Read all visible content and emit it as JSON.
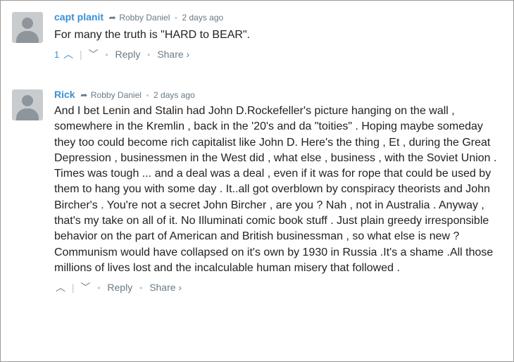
{
  "comments": [
    {
      "author": "capt planit",
      "reply_to": "Robby Daniel",
      "time": "2 days ago",
      "message": "For many the truth is \"HARD to BEAR\".",
      "votes": "1",
      "reply_label": "Reply",
      "share_label": "Share ›"
    },
    {
      "author": "Rick",
      "reply_to": "Robby Daniel",
      "time": "2 days ago",
      "message": "And I bet Lenin and Stalin had John D.Rockefeller's picture hanging on the wall , somewhere in the Kremlin , back in the '20's and da \"toities\" . Hoping maybe someday they too could become rich capitalist like John D. Here's the thing , Et , during the Great Depression , businessmen in the West did , what else , business , with the Soviet Union . Times was tough ... and a deal was a deal , even if it was for rope that could be used by them to hang you with some day . It..all got overblown by conspiracy theorists and John Bircher's . You're not a secret John Bircher , are you ? Nah , not in Australia . Anyway , that's my take on all of it. No Illuminati comic book stuff . Just plain greedy irresponsible behavior on the part of American and British businessman , so what else is new ? Communism would have collapsed on it's own by 1930 in Russia .It's a shame .All those millions of lives lost and the incalculable human misery that followed .",
      "reply_label": "Reply",
      "share_label": "Share ›"
    }
  ],
  "icons": {
    "avatar": "default-user-avatar",
    "reply_arrow": "reply-arrow-icon",
    "upvote": "chevron-up-icon",
    "downvote": "chevron-down-icon"
  },
  "colors": {
    "author": "#3a8fd4",
    "meta": "#687a86",
    "text": "#222222",
    "border": "#9a9a9a"
  }
}
